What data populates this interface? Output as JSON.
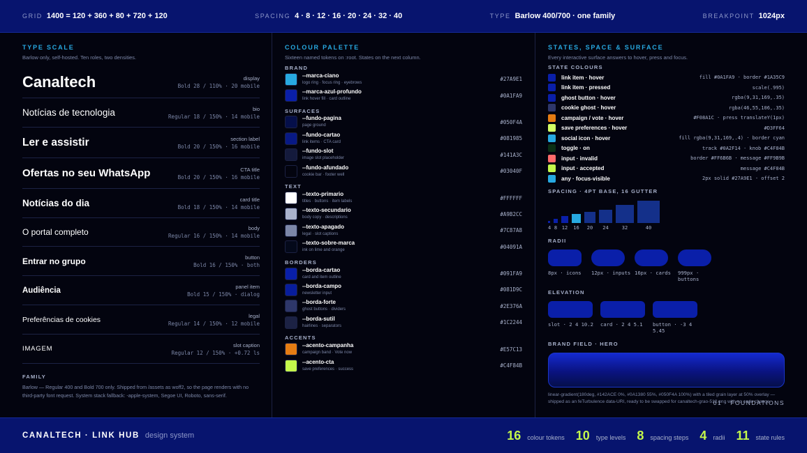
{
  "topbar": [
    {
      "label": "GRID",
      "value": "1400 = 120 + 360 + 80 + 720 + 120"
    },
    {
      "label": "SPACING",
      "value": "4 · 8 · 12 · 16 · 20 · 24 · 32 · 40"
    },
    {
      "label": "TYPE",
      "value": "Barlow 400/700 · one family"
    },
    {
      "label": "BREAKPOINT",
      "value": "1024px"
    }
  ],
  "type_scale": {
    "title": "TYPE SCALE",
    "subtitle": "Barlow only, self-hosted. Ten roles, two densities.",
    "rows": [
      {
        "sample": "Canaltech",
        "role": "display",
        "spec": "Bold 28 / 110% · 20 mobile"
      },
      {
        "sample": "Notícias de tecnologia",
        "role": "bio",
        "spec": "Regular 18 / 150% · 14 mobile"
      },
      {
        "sample": "Ler e assistir",
        "role": "section label",
        "spec": "Bold 20 / 150% · 16 mobile"
      },
      {
        "sample": "Ofertas no seu WhatsApp",
        "role": "CTA title",
        "spec": "Bold 20 / 150% · 16 mobile"
      },
      {
        "sample": "Notícias do dia",
        "role": "card title",
        "spec": "Bold 18 / 150% · 14 mobile"
      },
      {
        "sample": "O portal completo",
        "role": "body",
        "spec": "Regular 16 / 150% · 14 mobile"
      },
      {
        "sample": "Entrar no grupo",
        "role": "button",
        "spec": "Bold 16 / 150% · both"
      },
      {
        "sample": "Audiência",
        "role": "panel item",
        "spec": "Bold 15 / 150% · dialog"
      },
      {
        "sample": "Preferências de cookies",
        "role": "legal",
        "spec": "Regular 14 / 150% · 12 mobile"
      },
      {
        "sample": "IMAGEM",
        "role": "slot caption",
        "spec": "Regular 12 / 150% · +0.72 ls"
      }
    ],
    "family_title": "FAMILY",
    "family_text": "Barlow — Regular 400 and Bold 700 only. Shipped from /assets as woff2, so the page renders with no third-party font request. System stack fallback: -apple-system, Segoe UI, Roboto, sans-serif."
  },
  "palette": {
    "title": "COLOUR PALETTE",
    "subtitle": "Sixteen named tokens on :root. States on the next column.",
    "groups": [
      {
        "name": "BRAND",
        "items": [
          {
            "name": "--marca-ciano",
            "use": "logo ring · focus ring · eyebrows",
            "hex": "#27A9E1"
          },
          {
            "name": "--marca-azul-profundo",
            "use": "link hover fill · card outline",
            "hex": "#0A1FA9"
          }
        ]
      },
      {
        "name": "SURFACES",
        "items": [
          {
            "name": "--fundo-pagina",
            "use": "page ground",
            "hex": "#050F4A"
          },
          {
            "name": "--fundo-cartao",
            "use": "link items · CTA card",
            "hex": "#081985"
          },
          {
            "name": "--fundo-slot",
            "use": "image slot placeholder",
            "hex": "#141A3C"
          },
          {
            "name": "--fundo-afundado",
            "use": "cookie bar · footer well",
            "hex": "#03040F"
          }
        ]
      },
      {
        "name": "TEXT",
        "items": [
          {
            "name": "--texto-primario",
            "use": "titles · buttons · item labels",
            "hex": "#FFFFFF"
          },
          {
            "name": "--texto-secundario",
            "use": "body copy · descriptions",
            "hex": "#A9B2CC"
          },
          {
            "name": "--texto-apagado",
            "use": "legal · slot captions",
            "hex": "#7C87A8"
          },
          {
            "name": "--texto-sobre-marca",
            "use": "ink on lime and orange",
            "hex": "#04091A"
          }
        ]
      },
      {
        "name": "BORDERS",
        "items": [
          {
            "name": "--borda-cartao",
            "use": "card and item outline",
            "hex": "#091FA9"
          },
          {
            "name": "--borda-campo",
            "use": "newsletter input",
            "hex": "#081D9C"
          },
          {
            "name": "--borda-forte",
            "use": "ghost buttons · dividers",
            "hex": "#2E376A"
          },
          {
            "name": "--borda-sutil",
            "use": "hairlines · separators",
            "hex": "#1C2244"
          }
        ]
      },
      {
        "name": "ACCENTS",
        "items": [
          {
            "name": "--acento-campanha",
            "use": "campaign band · Vote now",
            "hex": "#E57C13"
          },
          {
            "name": "--acento-cta",
            "use": "save preferences · success",
            "hex": "#C4F84B"
          }
        ]
      }
    ]
  },
  "states": {
    "title": "STATES, SPACE & SURFACE",
    "subtitle": "Every interactive surface answers to hover, press and focus.",
    "group_title": "STATE COLOURS",
    "rows": [
      {
        "name": "link item · hover",
        "spec": "fill #0A1FA9 · border #1A35C9",
        "color": "#0A1FA9"
      },
      {
        "name": "link item · pressed",
        "spec": "scale(.995)",
        "color": "#0A1FA9"
      },
      {
        "name": "ghost button · hover",
        "spec": "rgba(9,31,169,.35)",
        "color": "#0A1FA9"
      },
      {
        "name": "cookie ghost · hover",
        "spec": "rgba(46,55,106,.35)",
        "color": "#2E376A"
      },
      {
        "name": "campaign / vote · hover",
        "spec": "#F08A1C · press translateY(1px)",
        "color": "#E57C13"
      },
      {
        "name": "save preferences · hover",
        "spec": "#D3FF64",
        "color": "#D3FF64"
      },
      {
        "name": "social icon · hover",
        "spec": "fill rgba(9,31,169,.4) · border cyan",
        "color": "#27A9E1"
      },
      {
        "name": "toggle · on",
        "spec": "track #0A2F14 · knob #C4F84B",
        "color": "#0A2F14"
      },
      {
        "name": "input · invalid",
        "spec": "border #FF6B6B · message #FF9B9B",
        "color": "#FF6B6B"
      },
      {
        "name": "input · accepted",
        "spec": "message #C4F84B",
        "color": "#C4F84B"
      },
      {
        "name": "any · focus-visible",
        "spec": "2px solid #27A9E1 · offset 2",
        "color": "#27A9E1"
      }
    ],
    "spacing_title": "SPACING · 4PT BASE, 16 GUTTER",
    "spacing_steps": [
      4,
      8,
      12,
      16,
      20,
      24,
      32,
      40
    ],
    "spacing_labels": [
      "4",
      "8",
      "12",
      "16",
      "20",
      "24",
      "32",
      "40"
    ],
    "radii_title": "RADII",
    "radii": [
      {
        "value": 8,
        "label": "8px · icons"
      },
      {
        "value": 12,
        "label": "12px · inputs"
      },
      {
        "value": 16,
        "label": "16px · cards"
      },
      {
        "value": 999,
        "label": "999px · buttons"
      }
    ],
    "elevation_title": "ELEVATION",
    "elevation": [
      {
        "label": "slot · 2 4 10.2"
      },
      {
        "label": "card · 2 4 5.1"
      },
      {
        "label": "button · -3 4 5.45"
      }
    ],
    "hero_title": "BRAND FIELD · HERO",
    "hero_text": "linear-gradient(180deg, #142ACE 0%, #0A1380 55%, #050F4A 100%) with a tiled grain layer at 50% overlay — shipped as an feTurbulence data-URI, ready to be swapped for canaltech-grao-512.png with no code change.",
    "foundations": "01 · FOUNDATIONS"
  },
  "footer": {
    "brand": "CANALTECH · LINK HUB",
    "brand_sub": "design system",
    "stats": [
      {
        "num": "16",
        "label": "colour tokens"
      },
      {
        "num": "10",
        "label": "type levels"
      },
      {
        "num": "8",
        "label": "spacing steps"
      },
      {
        "num": "4",
        "label": "radii"
      },
      {
        "num": "11",
        "label": "state rules"
      }
    ]
  }
}
